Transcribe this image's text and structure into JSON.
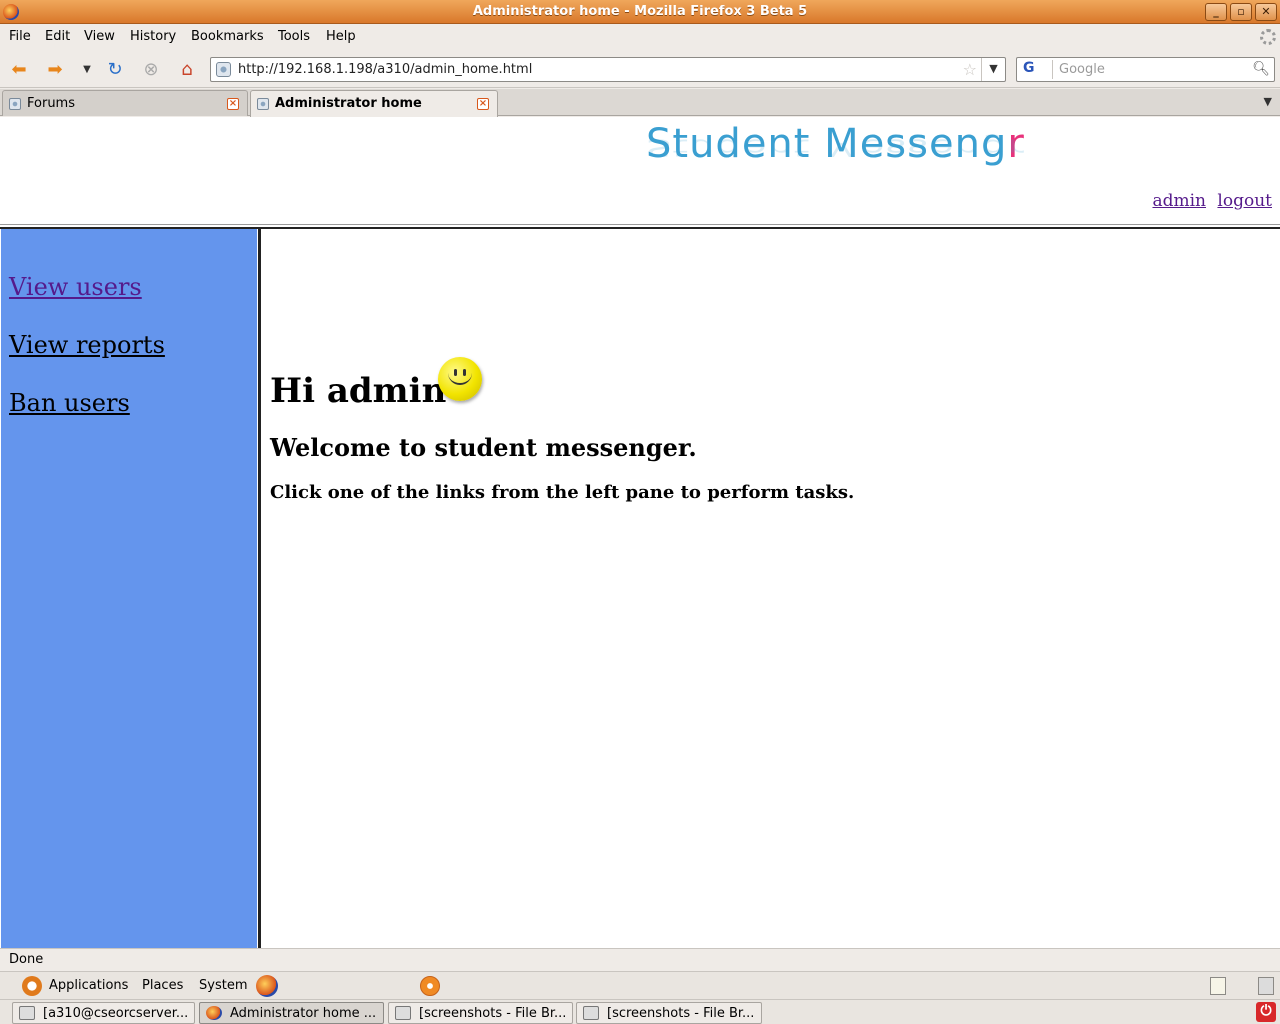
{
  "window": {
    "title": "Administrator home - Mozilla Firefox 3 Beta 5",
    "buttons": {
      "minimize": "_",
      "maximize": "▫",
      "close": "✕"
    }
  },
  "menu": [
    "File",
    "Edit",
    "View",
    "History",
    "Bookmarks",
    "Tools",
    "Help"
  ],
  "navigation": {
    "url": "http://192.168.1.198/a310/admin_home.html",
    "search_placeholder": "Google",
    "search_engine": "G"
  },
  "tabs": [
    {
      "label": "Forums",
      "active": false
    },
    {
      "label": "Administrator home",
      "active": true
    }
  ],
  "page": {
    "logo_text": "Student Messeng",
    "logo_suffix": "r",
    "user_links": {
      "user": "admin",
      "logout": "logout"
    },
    "sidebar": {
      "links": [
        "View users",
        "View reports",
        "Ban users"
      ]
    },
    "greeting": "Hi admin",
    "welcome": "Welcome to student messenger.",
    "instructions": "Click one of the links from the left pane to perform tasks."
  },
  "status": {
    "text": "Done"
  },
  "desktop_panel": {
    "menus": [
      "Applications",
      "Places",
      "System"
    ],
    "taskbar": [
      {
        "label": "[a310@cseorcserver...",
        "active": false
      },
      {
        "label": "Administrator home ...",
        "active": true
      },
      {
        "label": "[screenshots - File Br...",
        "active": false
      },
      {
        "label": "[screenshots - File Br...",
        "active": false
      }
    ]
  },
  "colors": {
    "titlebar": "#e08a3c",
    "sidebar": "#6495ed",
    "logo_blue": "#3a9fd1",
    "logo_pink": "#e8327b",
    "visited_link": "#551a8b"
  }
}
